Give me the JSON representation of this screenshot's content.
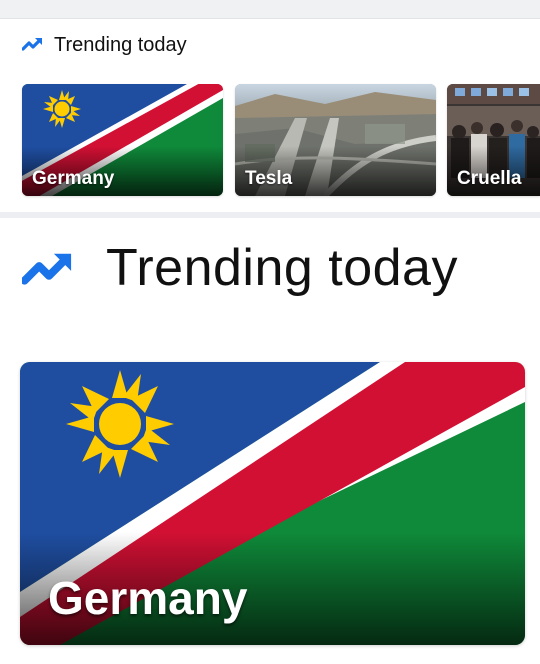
{
  "section": {
    "title": "Trending today",
    "icon": "trending-up-icon",
    "accent": "#1a73e8"
  },
  "cards": [
    {
      "label": "Germany",
      "image": "namibia-flag-image"
    },
    {
      "label": "Tesla",
      "image": "highway-aerial-image"
    },
    {
      "label": "Cruella",
      "image": "crowd-venue-image"
    }
  ],
  "zoomed": {
    "title": "Trending today",
    "card_label": "Germany"
  },
  "colors": {
    "flag_blue": "#1f4ea1",
    "flag_red": "#d21034",
    "flag_green": "#0f8a3a",
    "flag_white": "#ffffff",
    "sun_yellow": "#ffcc00"
  }
}
